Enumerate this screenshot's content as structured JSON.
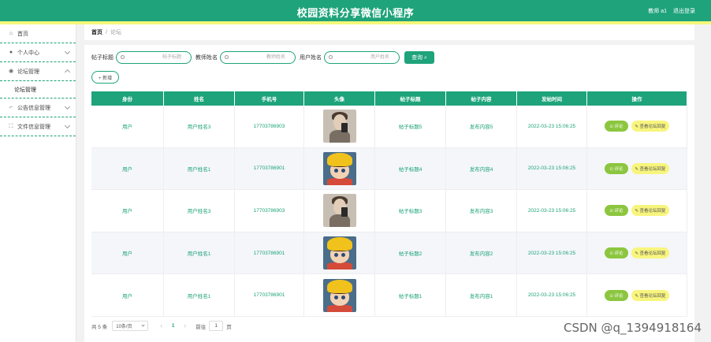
{
  "header": {
    "title": "校园资料分享微信小程序",
    "user": "教师 a1",
    "logout": "退出登录"
  },
  "sidebar": {
    "items": [
      {
        "label": "首页",
        "icon": "home-icon",
        "glyph": "⌂"
      },
      {
        "label": "个人中心",
        "icon": "user-icon",
        "glyph": "●"
      },
      {
        "label": "论坛管理",
        "icon": "location-icon",
        "glyph": "◉"
      },
      {
        "label": "公告信息管理",
        "icon": "crop-icon",
        "glyph": "⌐"
      },
      {
        "label": "文件信息管理",
        "icon": "fullscreen-icon",
        "glyph": "⛶"
      }
    ],
    "submenu": "论坛管理"
  },
  "breadcrumb": {
    "home": "首页",
    "sep": "/",
    "current": "论坛"
  },
  "search": {
    "title_label": "帖子标题",
    "title_placeholder": "帖子标题",
    "teacher_label": "教师姓名",
    "teacher_placeholder": "教师姓名",
    "user_label": "用户姓名",
    "user_placeholder": "用户姓名",
    "button": "查询 ⌕"
  },
  "add_button": "+ 新增",
  "table": {
    "headers": [
      "身份",
      "姓名",
      "手机号",
      "头像",
      "帖子标题",
      "帖子内容",
      "发帖时间",
      "操作"
    ],
    "rows": [
      {
        "role": "用户",
        "name": "用户姓名3",
        "phone": "17703786903",
        "avatar": "a3",
        "title": "帖子标题5",
        "content": "发布内容5",
        "time": "2022-03-23 15:06:25"
      },
      {
        "role": "用户",
        "name": "用户姓名1",
        "phone": "17703786901",
        "avatar": "a1",
        "title": "帖子标题4",
        "content": "发布内容4",
        "time": "2022-03-23 15:06:25"
      },
      {
        "role": "用户",
        "name": "用户姓名3",
        "phone": "17703786903",
        "avatar": "a3",
        "title": "帖子标题3",
        "content": "发布内容3",
        "time": "2022-03-23 15:06:25"
      },
      {
        "role": "用户",
        "name": "用户姓名1",
        "phone": "17703786901",
        "avatar": "a1",
        "title": "帖子标题2",
        "content": "发布内容2",
        "time": "2022-03-23 15:06:25"
      },
      {
        "role": "用户",
        "name": "用户姓名1",
        "phone": "17703786901",
        "avatar": "a1",
        "title": "帖子标题1",
        "content": "发布内容1",
        "time": "2022-03-23 15:06:25"
      }
    ],
    "reply_label": "⊙ 评论",
    "view_label": "✎ 查看论坛回复"
  },
  "pagination": {
    "total": "共 5 条",
    "size": "10条/页",
    "prev": "‹",
    "page": "1",
    "next": "›",
    "goto": "前往",
    "jump_value": "1",
    "page_unit": "页"
  },
  "watermark": "CSDN @q_1394918164",
  "colors": {
    "primary": "#1ea37a",
    "accent_yellow": "#f4f77a",
    "reply_green": "#8cc63f"
  }
}
